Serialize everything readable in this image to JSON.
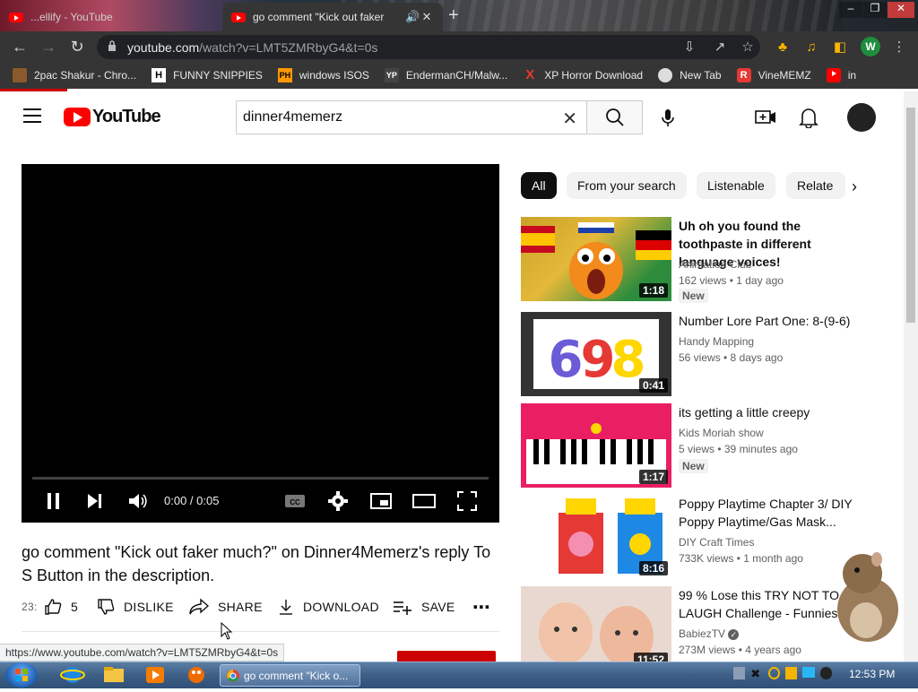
{
  "browser": {
    "tabs": [
      {
        "title": "...ellify - YouTube",
        "active": false
      },
      {
        "title": "go comment \"Kick out faker",
        "active": true
      }
    ],
    "url_host": "youtube.com",
    "url_path": "/watch?v=LMT5ZMRbyG4&t=0s",
    "profile_initial": "W",
    "bookmarks": [
      {
        "label": "2pac Shakur - Chro...",
        "icon": "2pac-icon"
      },
      {
        "label": "FUNNY SNIPPIES",
        "icon": "H"
      },
      {
        "label": "windows ISOS",
        "icon": "PH"
      },
      {
        "label": "EndermanCH/Malw...",
        "icon": "YP"
      },
      {
        "label": "XP Horror Download",
        "icon": "X"
      },
      {
        "label": "New Tab",
        "icon": "globe-icon"
      },
      {
        "label": "VineMEMZ",
        "icon": "R"
      },
      {
        "label": "in",
        "icon": "youtube-icon"
      }
    ]
  },
  "youtube": {
    "logo_text": "YouTube",
    "search_value": "dinner4memerz",
    "chips": [
      "All",
      "From your search",
      "Listenable",
      "Relate"
    ],
    "player": {
      "time": "0:00 / 0:05"
    },
    "video_title": "go comment \"Kick out faker much?\" on Dinner4Memerz's reply To S Button in the description.",
    "actions": {
      "views_partial": "23:",
      "likes": "5",
      "dislike": "DISLIKE",
      "share": "SHARE",
      "download": "DOWNLOAD",
      "save": "SAVE"
    },
    "recommendations": [
      {
        "title": "Uh oh you found the toothpaste in different language voices!",
        "channel": "Animation Club",
        "stats": "162 views • 1 day ago",
        "badge": "New",
        "duration": "1:18",
        "verified": false
      },
      {
        "title": "Number Lore Part One: 8-(9-6)",
        "channel": "Handy Mapping",
        "stats": "56 views • 8 days ago",
        "badge": "",
        "duration": "0:41",
        "verified": false
      },
      {
        "title": "its getting a little creepy",
        "channel": "Kids Moriah show",
        "stats": "5 views • 39 minutes ago",
        "badge": "New",
        "duration": "1:17",
        "verified": false
      },
      {
        "title": "Poppy Playtime Chapter 3/ DIY Poppy Playtime/Gas Mask...",
        "channel": "DIY Craft Times",
        "stats": "733K views • 1 month ago",
        "badge": "",
        "duration": "8:16",
        "verified": false
      },
      {
        "title": "99 % Lose this TRY NOT TO LAUGH Challenge - Funniest...",
        "channel": "BabiezTV",
        "stats": "273M views • 4 years ago",
        "badge": "",
        "duration": "11:52",
        "verified": true
      }
    ]
  },
  "status_url": "https://www.youtube.com/watch?v=LMT5ZMRbyG4&t=0s",
  "taskbar": {
    "chrome_task": "go comment \"Kick o...",
    "clock": "12:53 PM"
  },
  "colors": {
    "youtube_red": "#ff0000",
    "chrome_dark": "#353535",
    "taskbar_blue": "#3d5f86"
  }
}
